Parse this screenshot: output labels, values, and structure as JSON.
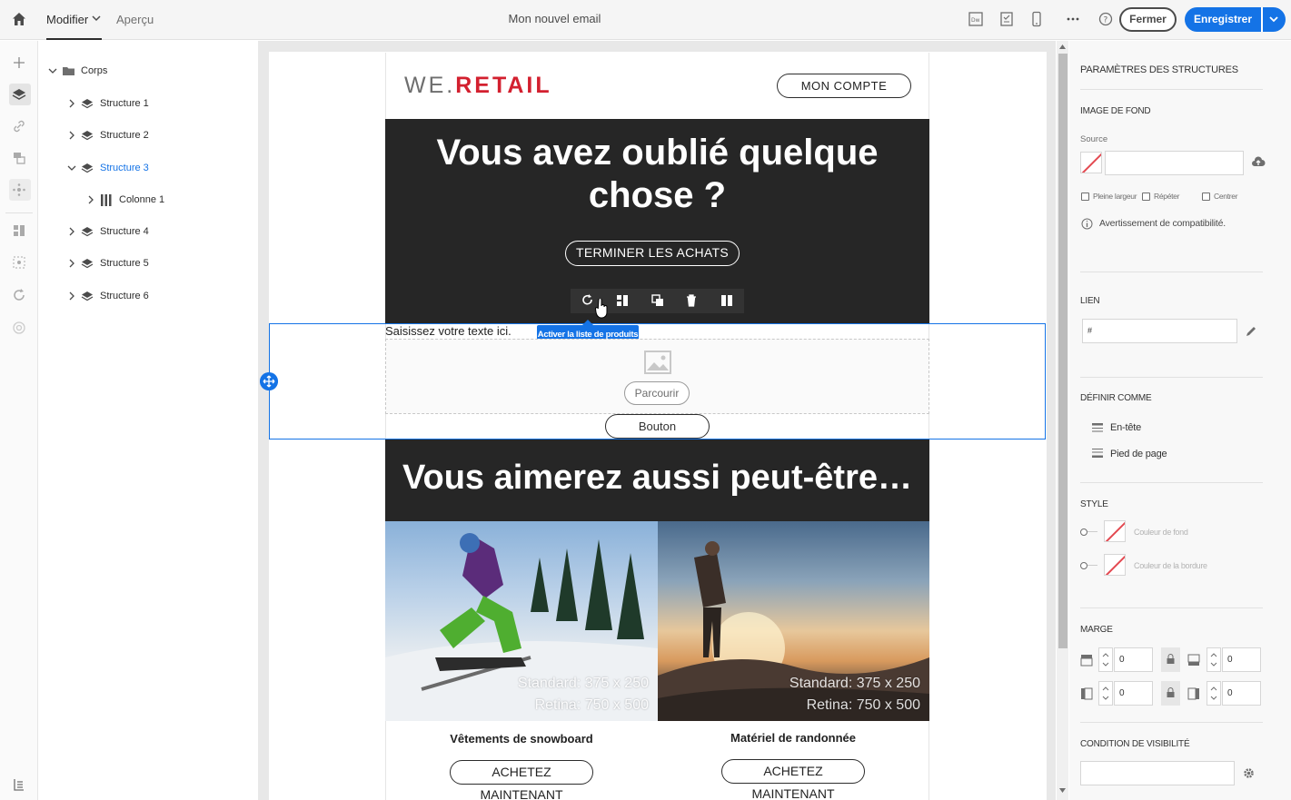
{
  "topbar": {
    "tab_edit": "Modifier",
    "tab_preview": "Aperçu",
    "document_title": "Mon nouvel email",
    "close_label": "Fermer",
    "save_label": "Enregistrer"
  },
  "tree": {
    "root": "Corps",
    "items": [
      {
        "label": "Structure 1"
      },
      {
        "label": "Structure 2"
      },
      {
        "label": "Structure 3"
      },
      {
        "label": "Colonne 1"
      },
      {
        "label": "Structure 4"
      },
      {
        "label": "Structure 5"
      },
      {
        "label": "Structure 6"
      }
    ],
    "selected": "Structure 3"
  },
  "email": {
    "logo_we": "WE.",
    "logo_retail": "RETAIL",
    "account_button": "MON COMPTE",
    "hero_title": "Vous avez oublié quelque chose ?",
    "checkout_button": "TERMINER LES ACHATS",
    "tooltip": "Activer la liste de produits",
    "placeholder_text": "Saisissez votre texte ici.",
    "browse_button": "Parcourir",
    "generic_button": "Bouton",
    "section_title": "Vous aimerez aussi peut-être…",
    "products": [
      {
        "name": "Vêtements de snowboard",
        "cap1": "Standard: 375 x 250",
        "cap2": "Retina: 750 x 500",
        "button": "ACHETEZ MAINTENANT"
      },
      {
        "name": "Matériel de randonnée",
        "cap1": "Standard: 375 x 250",
        "cap2": "Retina: 750 x 500",
        "button": "ACHETEZ MAINTENANT"
      }
    ]
  },
  "panel": {
    "title": "PARAMÈTRES DES STRUCTURES",
    "bg_image": {
      "heading": "IMAGE DE FOND",
      "source_label": "Source",
      "full_width": "Pleine largeur",
      "repeat": "Répéter",
      "center": "Centrer",
      "compat_warning": "Avertissement de compatibilité."
    },
    "link": {
      "heading": "LIEN",
      "value": "#"
    },
    "define_as": {
      "heading": "DÉFINIR COMME",
      "header": "En-tête",
      "footer": "Pied de page"
    },
    "style": {
      "heading": "STYLE",
      "bg_color": "Couleur de fond",
      "border_color": "Couleur de la bordure"
    },
    "margin": {
      "heading": "MARGE",
      "top": "0",
      "bottom": "0",
      "left": "0",
      "right": "0"
    },
    "visibility": {
      "heading": "CONDITION DE VISIBILITÉ"
    }
  },
  "colors": {
    "accent": "#1473e6",
    "dark": "#262626",
    "brand_red": "#d3202f"
  }
}
